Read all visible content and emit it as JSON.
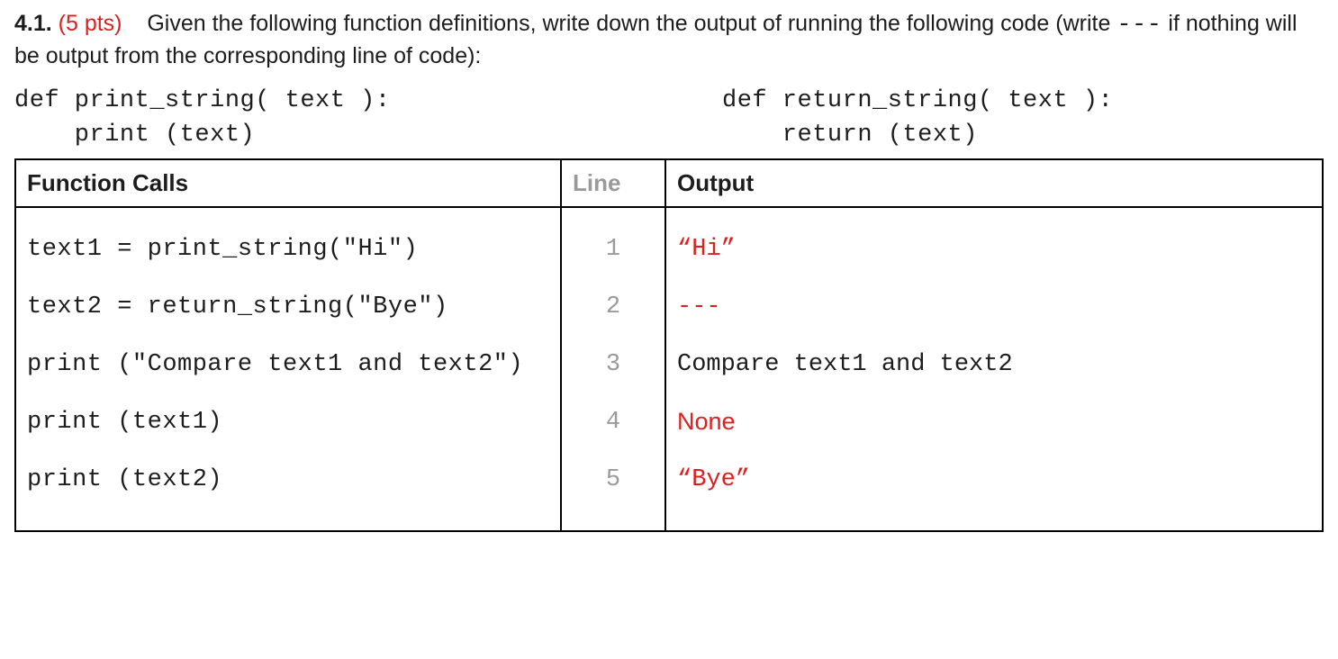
{
  "question": {
    "number": "4.1.",
    "points": "(5 pts)",
    "text_a": "Given the following function definitions, write down the output of running the following code (write ",
    "dashes": "---",
    "text_b": " if nothing will be output from the corresponding line of code):"
  },
  "defs": {
    "left": "def print_string( text ):\n    print (text)",
    "right": "def return_string( text ):\n    return (text)"
  },
  "headers": {
    "calls": "Function Calls",
    "line": "Line",
    "output": "Output"
  },
  "rows": [
    {
      "call": "text1 = print_string(\"Hi\")",
      "line": "1",
      "output": "“Hi”",
      "out_class": "red out-mono out-quoted"
    },
    {
      "call": "text2 = return_string(\"Bye\")",
      "line": "2",
      "output": "---",
      "out_class": "red out-mono"
    },
    {
      "call": "print (\"Compare text1 and text2\")",
      "line": "3",
      "output": "Compare text1 and text2",
      "out_class": "out-mono"
    },
    {
      "call": "print (text1)",
      "line": "4",
      "output": "None",
      "out_class": "red out-sans"
    },
    {
      "call": "print (text2)",
      "line": "5",
      "output": "“Bye”",
      "out_class": "red out-mono out-quoted"
    }
  ]
}
